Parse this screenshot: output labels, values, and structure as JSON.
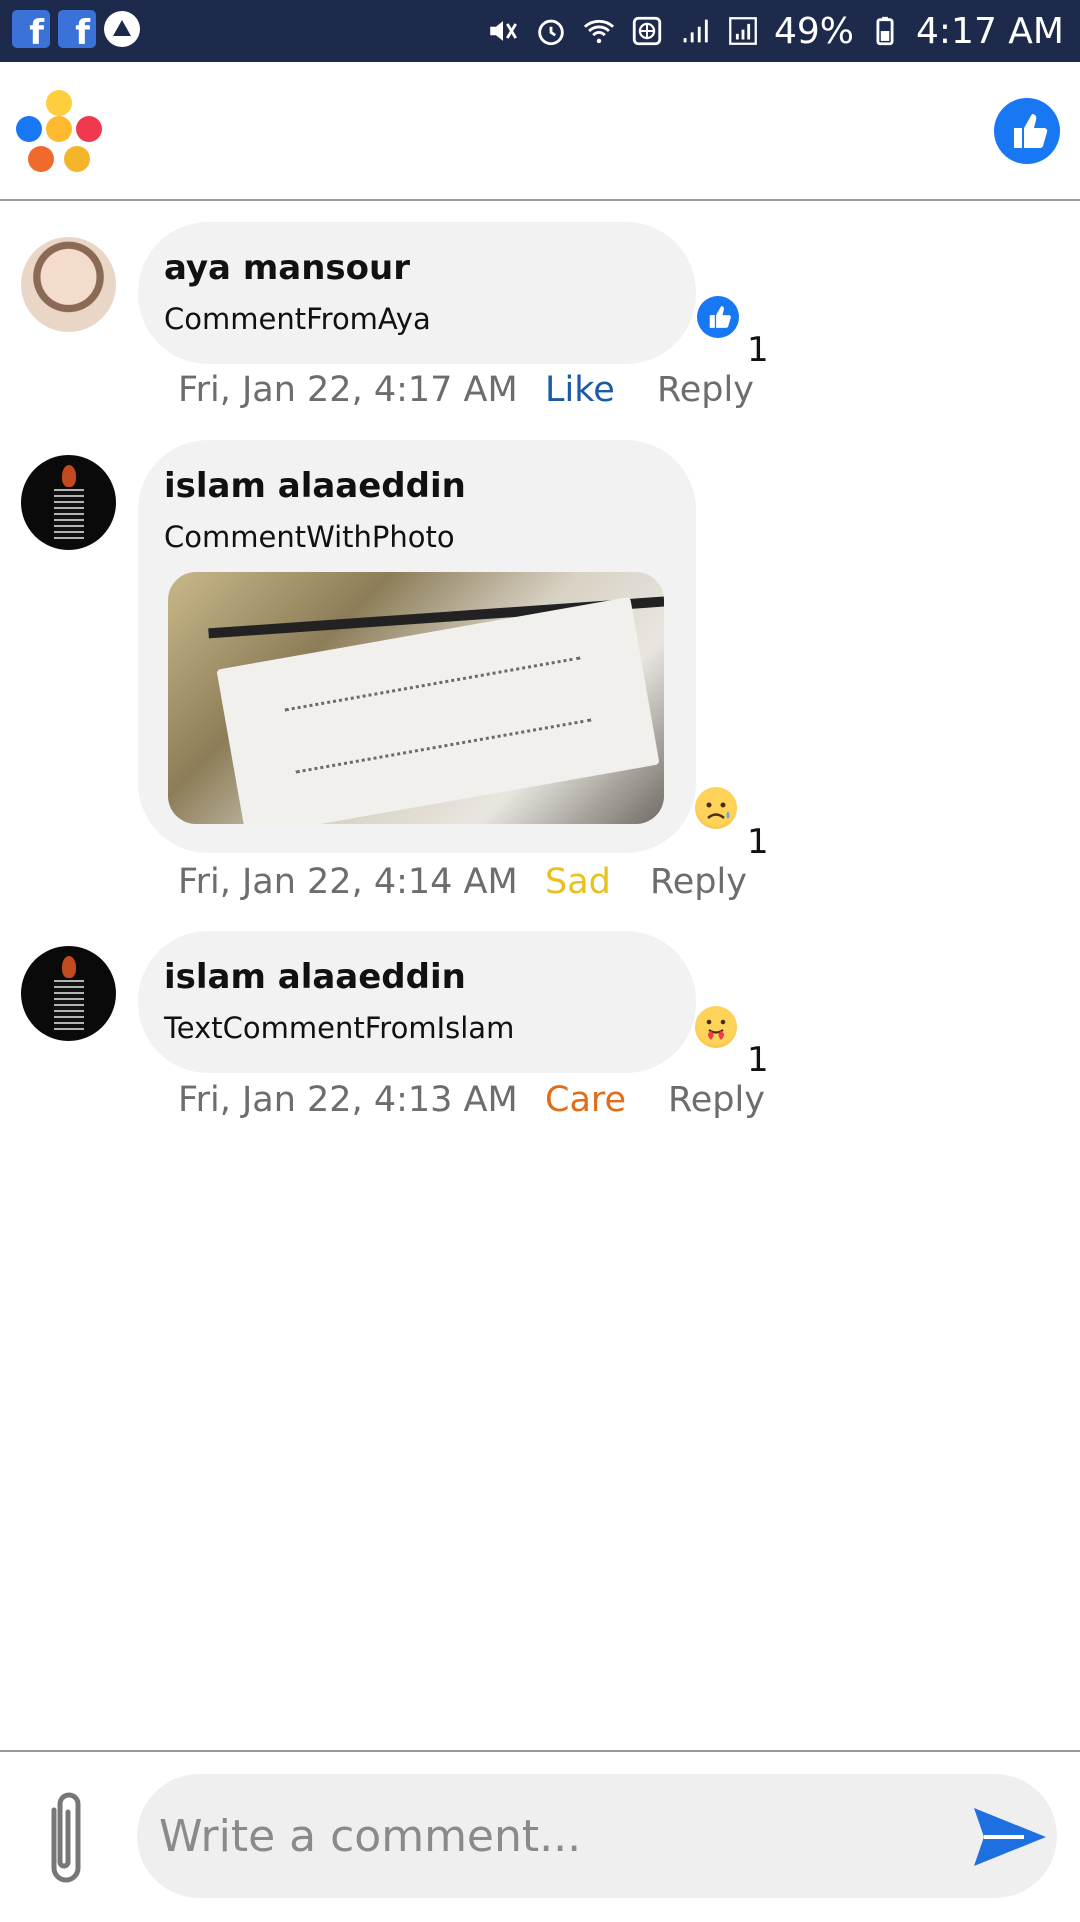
{
  "status_bar": {
    "left_icons": [
      "facebook-icon",
      "facebook-icon",
      "delta-icon"
    ],
    "right_icons": [
      "mute-icon",
      "alarm-icon",
      "wifi-icon",
      "globe-icon",
      "signal-icon",
      "signal-icon",
      "battery-icon"
    ],
    "battery": "49%",
    "time": "4:17 AM"
  },
  "header": {
    "left_icon": "reactions-cluster-icon",
    "right_icon": "like-icon"
  },
  "comments": [
    {
      "author": "aya mansour",
      "text": "CommentFromAya",
      "timestamp": "Fri, Jan 22, 4:17 AM",
      "reaction_label": "Like",
      "reaction_icon": "like-icon",
      "reaction_count": "1",
      "reply_label": "Reply"
    },
    {
      "author": "islam alaaeddin",
      "text": "CommentWithPhoto",
      "timestamp": "Fri, Jan 22, 4:14 AM",
      "reaction_label": "Sad",
      "reaction_icon": "sad-icon",
      "reaction_count": "1",
      "reply_label": "Reply"
    },
    {
      "author": "islam alaaeddin",
      "text": "TextCommentFromIslam",
      "timestamp": "Fri, Jan 22, 4:13 AM",
      "reaction_label": "Care",
      "reaction_icon": "care-icon",
      "reaction_count": "1",
      "reply_label": "Reply"
    }
  ],
  "composer": {
    "placeholder": "Write a comment...",
    "attach_icon": "paperclip-icon",
    "send_icon": "send-icon"
  },
  "colors": {
    "status_bar": "#1d2a4b",
    "facebook_blue": "#1877f2",
    "like_text": "#1b5aa6",
    "sad_text": "#e8c21c",
    "care_text": "#e06e18",
    "bubble": "#f2f2f2"
  }
}
